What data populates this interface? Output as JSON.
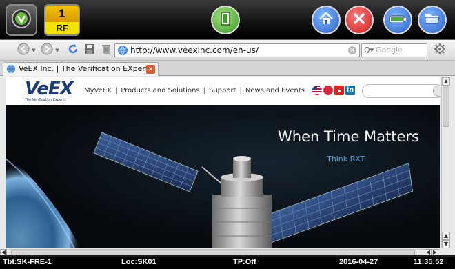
{
  "toolbar": {
    "rf_number": "1",
    "rf_label": "RF",
    "icons": [
      "veex-logo-icon",
      "exit-door-icon",
      "home-icon",
      "close-icon",
      "battery-icon",
      "folder-icon"
    ]
  },
  "browser": {
    "url": "http://www.veexinc.com/en-us/",
    "search_placeholder": "Google",
    "tab_title": "VeEX Inc. | The Verification EXperts"
  },
  "site": {
    "logo_text": "VeEX",
    "logo_tagline": "The Verification Experts",
    "nav": [
      "MyVeEX",
      "Products and Solutions",
      "Support",
      "News and Events"
    ],
    "hero_title": "When Time Matters",
    "hero_subtitle": "Think RXT"
  },
  "status": {
    "table": "Tbl:SK-FRE-1",
    "location": "Loc:SK01",
    "tp": "TP:Off",
    "date": "2016-04-27",
    "time": "11:35:52"
  },
  "colors": {
    "accent_blue": "#2f6fd0",
    "close_red": "#d92a2a",
    "exit_green": "#4caf3a",
    "rf_yellow": "#f3e200"
  }
}
